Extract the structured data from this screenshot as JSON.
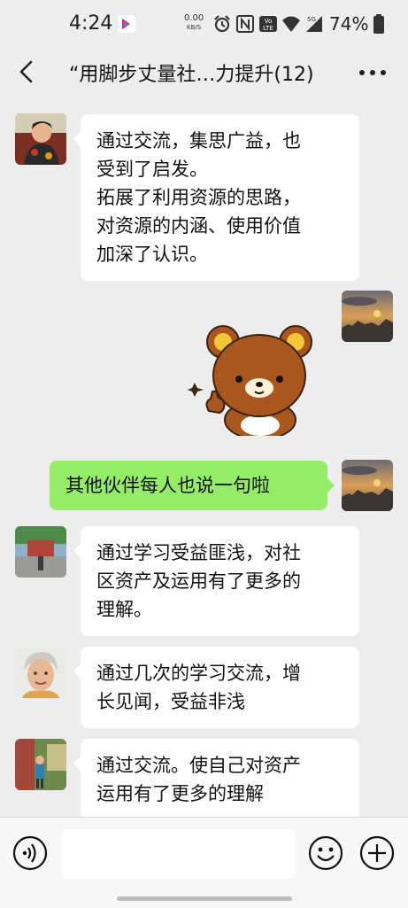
{
  "status_bar": {
    "time": "4:24",
    "net_speed_value": "0.00",
    "net_speed_unit": "KB/S",
    "battery_percent": "74%",
    "icons": [
      "app-notification-icon",
      "alarm-icon",
      "nfc-icon",
      "volte-icon",
      "wifi-icon",
      "signal-5g-icon",
      "battery-icon"
    ]
  },
  "header": {
    "title": "“用脚步丈量社…力提升(12)",
    "back_icon": "back-arrow-icon",
    "more_icon": "more-options-icon"
  },
  "messages": [
    {
      "side": "left",
      "avatar": "member-avatar-1",
      "lines": [
        "通过交流，集思广益，也",
        "受到了启发。",
        "拓展了利用资源的思路，",
        "对资源的内涵、使用价值",
        "加深了认识。"
      ]
    },
    {
      "side": "right",
      "avatar": "self-avatar",
      "type": "sticker",
      "sticker": "rilakkuma-thumbs-up-sticker"
    },
    {
      "side": "right",
      "avatar": "self-avatar",
      "lines": [
        "其他伙伴每人也说一句啦"
      ]
    },
    {
      "side": "left",
      "avatar": "member-avatar-2",
      "lines": [
        "通过学习受益匪浅，对社",
        "区资产及运用有了更多的",
        "理解。"
      ]
    },
    {
      "side": "left",
      "avatar": "member-avatar-3",
      "lines": [
        "通过几次的学习交流，增",
        "长见闻，受益非浅"
      ]
    },
    {
      "side": "left",
      "avatar": "member-avatar-4",
      "lines": [
        "通过交流。使自己对资产",
        "运用有了更多的理解"
      ]
    }
  ],
  "input_bar": {
    "voice_icon": "voice-input-icon",
    "text_value": "",
    "emoji_icon": "emoji-icon",
    "plus_icon": "more-functions-icon"
  },
  "colors": {
    "background": "#ededed",
    "sent_bubble": "#95ec69",
    "received_bubble": "#ffffff"
  }
}
